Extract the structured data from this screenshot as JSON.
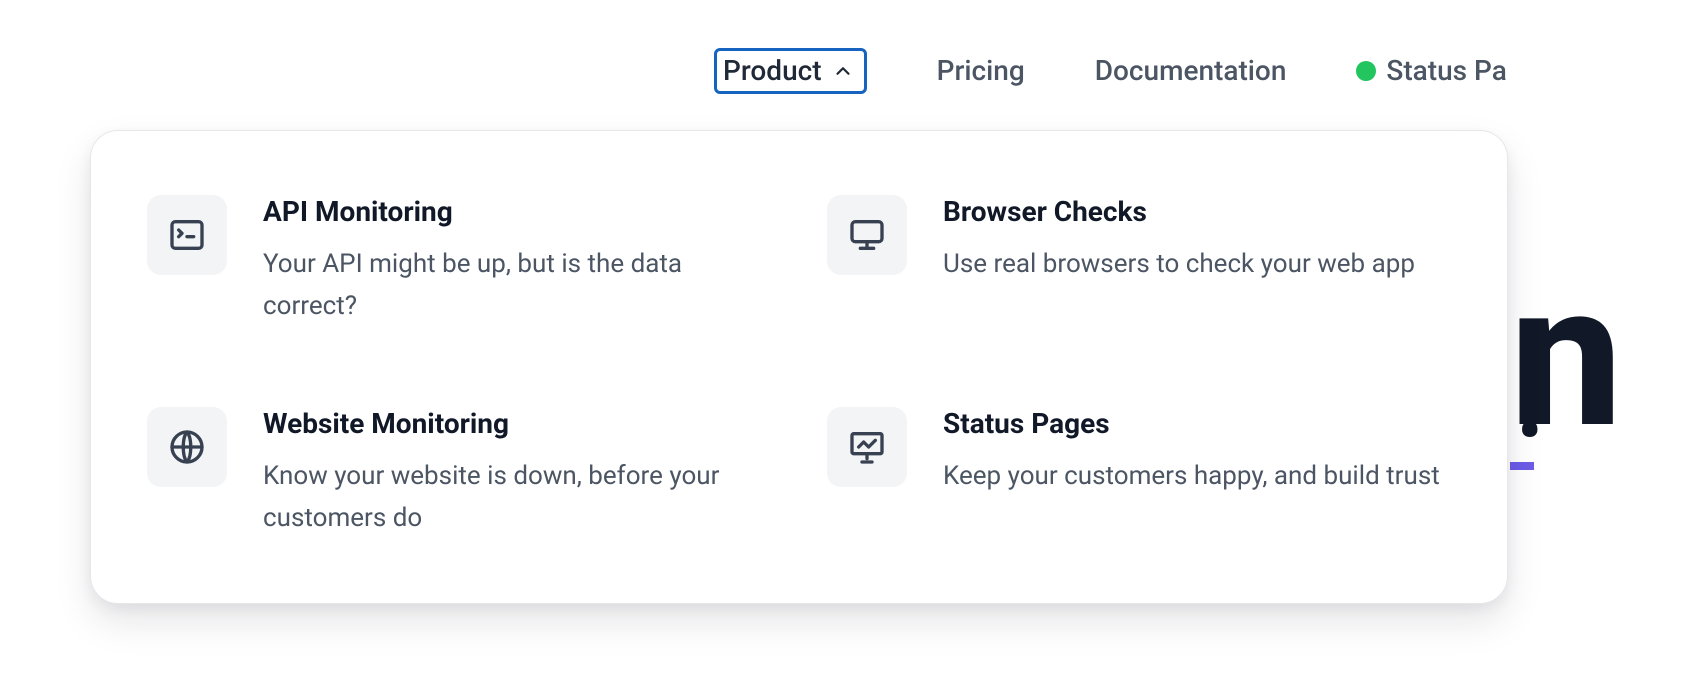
{
  "nav": {
    "product": "Product",
    "pricing": "Pricing",
    "documentation": "Documentation",
    "status_page": "Status Pa"
  },
  "dropdown": {
    "items": [
      {
        "icon": "terminal-icon",
        "title": "API Monitoring",
        "desc": "Your API might be up, but is the data correct?"
      },
      {
        "icon": "desktop-icon",
        "title": "Browser Checks",
        "desc": "Use real browsers to check your web app"
      },
      {
        "icon": "globe-icon",
        "title": "Website Monitoring",
        "desc": "Know your website is down, before your customers do"
      },
      {
        "icon": "presentation-icon",
        "title": "Status Pages",
        "desc": "Keep your customers happy, and build trust"
      }
    ]
  },
  "colors": {
    "status_dot": "#22C55E",
    "active_border": "#1664C0"
  }
}
